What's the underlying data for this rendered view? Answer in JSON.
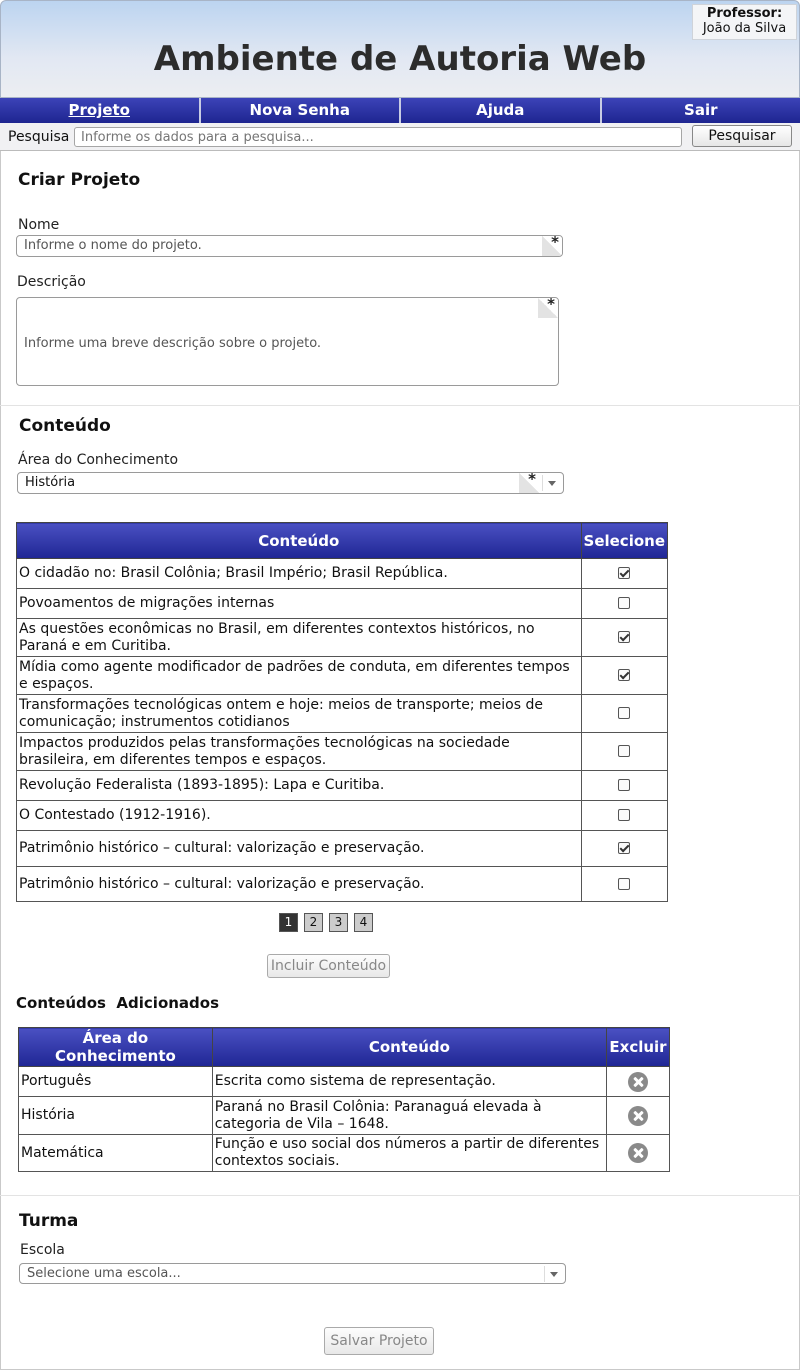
{
  "header": {
    "title": "Ambiente de Autoria Web",
    "professor_label": "Professor:",
    "professor_name": "João da Silva"
  },
  "nav": {
    "tabs": [
      {
        "label": "Projeto",
        "active": true
      },
      {
        "label": "Nova Senha"
      },
      {
        "label": "Ajuda"
      },
      {
        "label": "Sair"
      }
    ]
  },
  "search": {
    "label": "Pesquisa",
    "placeholder": "Informe os dados para a pesquisa...",
    "button": "Pesquisar"
  },
  "criar": {
    "title": "Criar Projeto",
    "nome_label": "Nome",
    "nome_placeholder": "Informe o nome do projeto.",
    "descricao_label": "Descrição",
    "descricao_placeholder": "Informe uma breve descrição sobre o projeto.",
    "required_mark": "*"
  },
  "conteudo": {
    "title": "Conteúdo",
    "area_label": "Área do Conhecimento",
    "area_value": "História",
    "table_headers": [
      "Conteúdo",
      "Selecione"
    ],
    "rows": [
      {
        "text": "O cidadão no: Brasil Colônia; Brasil Império; Brasil República.",
        "checked": true
      },
      {
        "text": "Povoamentos de migrações internas",
        "checked": false
      },
      {
        "text": "As questões econômicas no Brasil, em diferentes contextos históricos, no Paraná e em Curitiba.",
        "checked": true
      },
      {
        "text": "Mídia como agente modificador de padrões de conduta, em diferentes tempos e espaços.",
        "checked": true
      },
      {
        "text": "Transformações tecnológicas ontem e hoje: meios de transporte; meios de comunicação; instrumentos cotidianos",
        "checked": false
      },
      {
        "text": "Impactos  produzidos  pelas transformações  tecnológicas  na sociedade brasileira, em diferentes tempos e espaços.",
        "checked": false
      },
      {
        "text": "Revolução Federalista (1893-1895): Lapa e Curitiba.",
        "checked": false
      },
      {
        "text": "O Contestado (1912-1916).",
        "checked": false
      },
      {
        "text": "Patrimônio histórico – cultural: valorização e preservação.",
        "checked": true
      },
      {
        "text": "Patrimônio histórico – cultural: valorização e preservação.",
        "checked": false
      }
    ],
    "pages": [
      "1",
      "2",
      "3",
      "4"
    ],
    "current_page": "1",
    "incluir_button": "Incluir Conteúdo"
  },
  "adicionados": {
    "title": "Conteúdos  Adicionados",
    "headers": [
      "Área do Conhecimento",
      "Conteúdo",
      "Excluir"
    ],
    "rows": [
      {
        "area": "Português",
        "conteudo": "Escrita como sistema de representação."
      },
      {
        "area": "História",
        "conteudo": "Paraná no Brasil Colônia: Paranaguá elevada à categoria de Vila – 1648."
      },
      {
        "area": "Matemática",
        "conteudo": "Função e uso social dos números a partir de diferentes contextos sociais."
      }
    ]
  },
  "turma": {
    "title": "Turma",
    "escola_label": "Escola",
    "escola_placeholder": "Selecione uma escola...",
    "salvar_button": "Salvar Projeto"
  }
}
